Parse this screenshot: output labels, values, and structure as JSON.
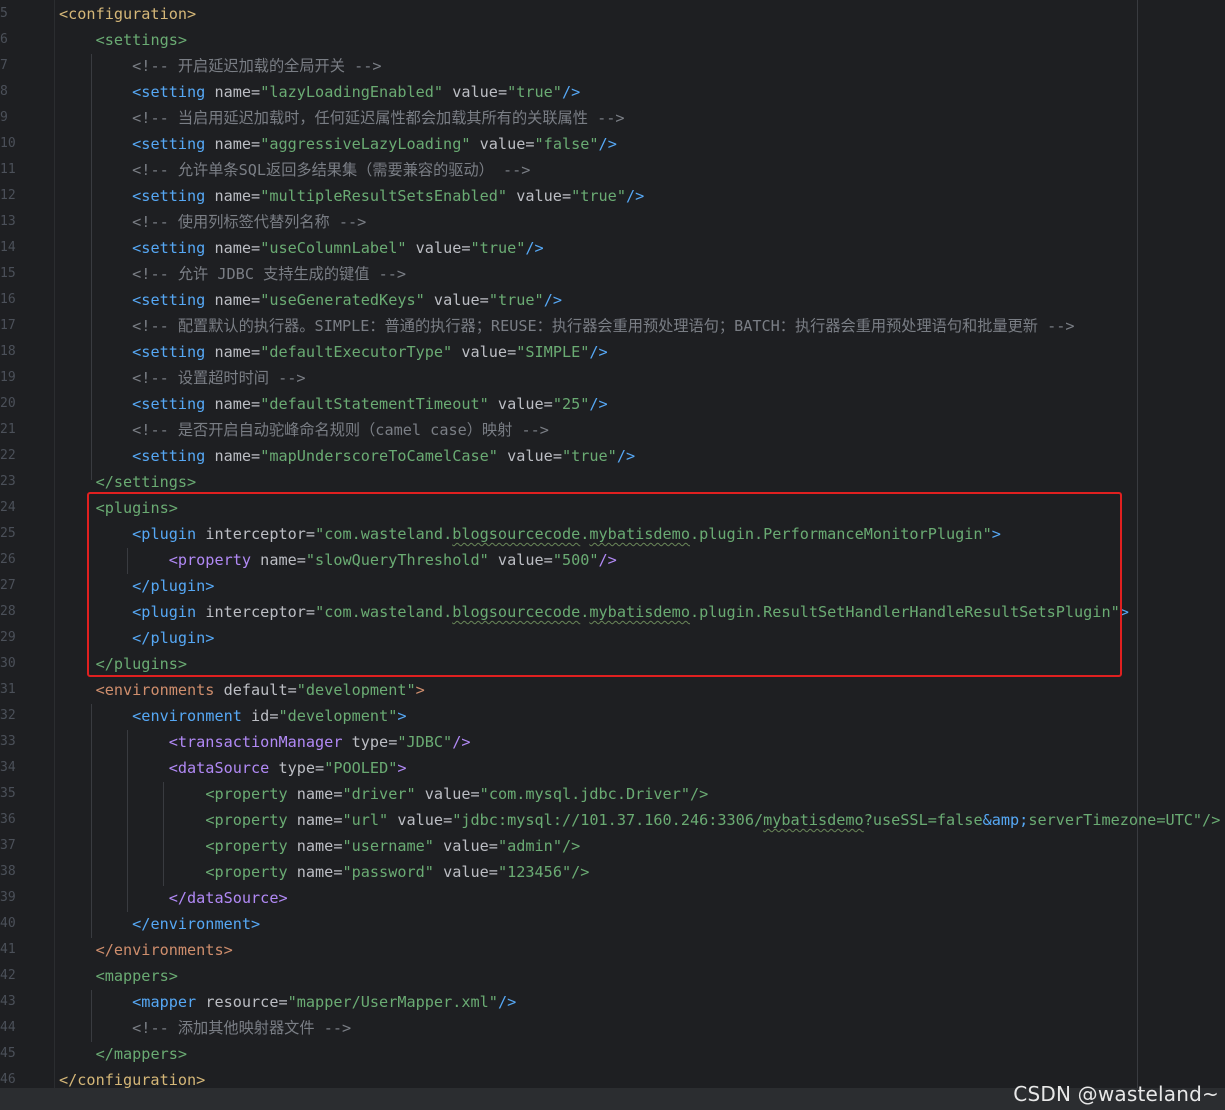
{
  "watermark": "CSDN @wasteland~",
  "colors": {
    "background": "#1e1f22",
    "highlight_box": "#e02020",
    "comment": "#7a7e85",
    "string": "#6aab73",
    "attribute": "#bcbec4"
  },
  "lines": [
    {
      "n": "5",
      "segs": [
        [
          "tag-y",
          "<configuration>"
        ]
      ]
    },
    {
      "n": "6",
      "segs": [
        [
          "sp",
          "    "
        ],
        [
          "tag-g",
          "<settings>"
        ]
      ]
    },
    {
      "n": "7",
      "segs": [
        [
          "sp",
          "        "
        ],
        [
          "cmt",
          "<!-- 开启延迟加载的全局开关 -->"
        ]
      ]
    },
    {
      "n": "8",
      "segs": [
        [
          "sp",
          "        "
        ],
        [
          "tag-b",
          "<setting "
        ],
        [
          "attr",
          "name"
        ],
        [
          "eq",
          "="
        ],
        [
          "str",
          "\"lazyLoadingEnabled\""
        ],
        [
          "attr",
          " value"
        ],
        [
          "eq",
          "="
        ],
        [
          "str",
          "\"true\""
        ],
        [
          "tag-b",
          "/>"
        ]
      ]
    },
    {
      "n": "9",
      "segs": [
        [
          "sp",
          "        "
        ],
        [
          "cmt",
          "<!-- 当启用延迟加载时，任何延迟属性都会加载其所有的关联属性 -->"
        ]
      ]
    },
    {
      "n": "10",
      "segs": [
        [
          "sp",
          "        "
        ],
        [
          "tag-b",
          "<setting "
        ],
        [
          "attr",
          "name"
        ],
        [
          "eq",
          "="
        ],
        [
          "str",
          "\"aggressiveLazyLoading\""
        ],
        [
          "attr",
          " value"
        ],
        [
          "eq",
          "="
        ],
        [
          "str",
          "\"false\""
        ],
        [
          "tag-b",
          "/>"
        ]
      ]
    },
    {
      "n": "11",
      "segs": [
        [
          "sp",
          "        "
        ],
        [
          "cmt",
          "<!-- 允许单条SQL返回多结果集（需要兼容的驱动） -->"
        ]
      ]
    },
    {
      "n": "12",
      "segs": [
        [
          "sp",
          "        "
        ],
        [
          "tag-b",
          "<setting "
        ],
        [
          "attr",
          "name"
        ],
        [
          "eq",
          "="
        ],
        [
          "str",
          "\"multipleResultSetsEnabled\""
        ],
        [
          "attr",
          " value"
        ],
        [
          "eq",
          "="
        ],
        [
          "str",
          "\"true\""
        ],
        [
          "tag-b",
          "/>"
        ]
      ]
    },
    {
      "n": "13",
      "segs": [
        [
          "sp",
          "        "
        ],
        [
          "cmt",
          "<!-- 使用列标签代替列名称 -->"
        ]
      ]
    },
    {
      "n": "14",
      "segs": [
        [
          "sp",
          "        "
        ],
        [
          "tag-b",
          "<setting "
        ],
        [
          "attr",
          "name"
        ],
        [
          "eq",
          "="
        ],
        [
          "str",
          "\"useColumnLabel\""
        ],
        [
          "attr",
          " value"
        ],
        [
          "eq",
          "="
        ],
        [
          "str",
          "\"true\""
        ],
        [
          "tag-b",
          "/>"
        ]
      ]
    },
    {
      "n": "15",
      "segs": [
        [
          "sp",
          "        "
        ],
        [
          "cmt",
          "<!-- 允许 JDBC 支持生成的键值 -->"
        ]
      ]
    },
    {
      "n": "16",
      "segs": [
        [
          "sp",
          "        "
        ],
        [
          "tag-b",
          "<setting "
        ],
        [
          "attr",
          "name"
        ],
        [
          "eq",
          "="
        ],
        [
          "str",
          "\"useGeneratedKeys\""
        ],
        [
          "attr",
          " value"
        ],
        [
          "eq",
          "="
        ],
        [
          "str",
          "\"true\""
        ],
        [
          "tag-b",
          "/>"
        ]
      ]
    },
    {
      "n": "17",
      "segs": [
        [
          "sp",
          "        "
        ],
        [
          "cmt",
          "<!-- 配置默认的执行器。SIMPLE：普通的执行器；REUSE：执行器会重用预处理语句；BATCH：执行器会重用预处理语句和批量更新 -->"
        ]
      ]
    },
    {
      "n": "18",
      "segs": [
        [
          "sp",
          "        "
        ],
        [
          "tag-b",
          "<setting "
        ],
        [
          "attr",
          "name"
        ],
        [
          "eq",
          "="
        ],
        [
          "str",
          "\"defaultExecutorType\""
        ],
        [
          "attr",
          " value"
        ],
        [
          "eq",
          "="
        ],
        [
          "str",
          "\"SIMPLE\""
        ],
        [
          "tag-b",
          "/>"
        ]
      ]
    },
    {
      "n": "19",
      "segs": [
        [
          "sp",
          "        "
        ],
        [
          "cmt",
          "<!-- 设置超时时间 -->"
        ]
      ]
    },
    {
      "n": "20",
      "segs": [
        [
          "sp",
          "        "
        ],
        [
          "tag-b",
          "<setting "
        ],
        [
          "attr",
          "name"
        ],
        [
          "eq",
          "="
        ],
        [
          "str",
          "\"defaultStatementTimeout\""
        ],
        [
          "attr",
          " value"
        ],
        [
          "eq",
          "="
        ],
        [
          "str",
          "\"25\""
        ],
        [
          "tag-b",
          "/>"
        ]
      ]
    },
    {
      "n": "21",
      "segs": [
        [
          "sp",
          "        "
        ],
        [
          "cmt",
          "<!-- 是否开启自动驼峰命名规则（camel case）映射 -->"
        ]
      ]
    },
    {
      "n": "22",
      "segs": [
        [
          "sp",
          "        "
        ],
        [
          "tag-b",
          "<setting "
        ],
        [
          "attr",
          "name"
        ],
        [
          "eq",
          "="
        ],
        [
          "str",
          "\"mapUnderscoreToCamelCase\""
        ],
        [
          "attr",
          " value"
        ],
        [
          "eq",
          "="
        ],
        [
          "str",
          "\"true\""
        ],
        [
          "tag-b",
          "/>"
        ]
      ]
    },
    {
      "n": "23",
      "segs": [
        [
          "sp",
          "    "
        ],
        [
          "tag-g",
          "</settings>"
        ]
      ]
    },
    {
      "n": "24",
      "segs": [
        [
          "sp",
          "    "
        ],
        [
          "tag-g",
          "<plugins>"
        ]
      ]
    },
    {
      "n": "25",
      "segs": [
        [
          "sp",
          "        "
        ],
        [
          "tag-b",
          "<plugin "
        ],
        [
          "attr",
          "interceptor"
        ],
        [
          "eq",
          "="
        ],
        [
          "str",
          "\"com.wasteland."
        ],
        [
          "sq",
          "blogsourcecode"
        ],
        [
          "str",
          "."
        ],
        [
          "sq",
          "mybatisdemo"
        ],
        [
          "str",
          ".plugin.PerformanceMonitorPlugin\""
        ],
        [
          "tag-b",
          ">"
        ]
      ]
    },
    {
      "n": "26",
      "segs": [
        [
          "sp",
          "            "
        ],
        [
          "tag-p",
          "<property "
        ],
        [
          "attr",
          "name"
        ],
        [
          "eq",
          "="
        ],
        [
          "str",
          "\"slowQueryThreshold\""
        ],
        [
          "attr",
          " value"
        ],
        [
          "eq",
          "="
        ],
        [
          "str",
          "\"500\""
        ],
        [
          "tag-p",
          "/>"
        ]
      ]
    },
    {
      "n": "27",
      "segs": [
        [
          "sp",
          "        "
        ],
        [
          "tag-b",
          "</plugin>"
        ]
      ]
    },
    {
      "n": "28",
      "segs": [
        [
          "sp",
          "        "
        ],
        [
          "tag-b",
          "<plugin "
        ],
        [
          "attr",
          "interceptor"
        ],
        [
          "eq",
          "="
        ],
        [
          "str",
          "\"com.wasteland."
        ],
        [
          "sq",
          "blogsourcecode"
        ],
        [
          "str",
          "."
        ],
        [
          "sq",
          "mybatisdemo"
        ],
        [
          "str",
          ".plugin.ResultSetHandlerHandleResultSetsPlugin\""
        ],
        [
          "tag-b",
          ">"
        ]
      ]
    },
    {
      "n": "29",
      "segs": [
        [
          "sp",
          "        "
        ],
        [
          "tag-b",
          "</plugin>"
        ]
      ]
    },
    {
      "n": "30",
      "segs": [
        [
          "sp",
          "    "
        ],
        [
          "tag-g",
          "</plugins>"
        ]
      ]
    },
    {
      "n": "31",
      "segs": [
        [
          "sp",
          "    "
        ],
        [
          "tag-o",
          "<environments "
        ],
        [
          "attr",
          "default"
        ],
        [
          "eq",
          "="
        ],
        [
          "str",
          "\"development\""
        ],
        [
          "tag-o",
          ">"
        ]
      ]
    },
    {
      "n": "32",
      "segs": [
        [
          "sp",
          "        "
        ],
        [
          "tag-b",
          "<environment "
        ],
        [
          "attr",
          "id"
        ],
        [
          "eq",
          "="
        ],
        [
          "str",
          "\"development\""
        ],
        [
          "tag-b",
          ">"
        ]
      ]
    },
    {
      "n": "33",
      "segs": [
        [
          "sp",
          "            "
        ],
        [
          "tag-p",
          "<transactionManager "
        ],
        [
          "attr",
          "type"
        ],
        [
          "eq",
          "="
        ],
        [
          "str",
          "\"JDBC\""
        ],
        [
          "tag-p",
          "/>"
        ]
      ]
    },
    {
      "n": "34",
      "segs": [
        [
          "sp",
          "            "
        ],
        [
          "tag-p",
          "<dataSource "
        ],
        [
          "attr",
          "type"
        ],
        [
          "eq",
          "="
        ],
        [
          "str",
          "\"POOLED\""
        ],
        [
          "tag-p",
          ">"
        ]
      ]
    },
    {
      "n": "35",
      "segs": [
        [
          "sp",
          "                "
        ],
        [
          "tag-g",
          "<property "
        ],
        [
          "attr",
          "name"
        ],
        [
          "eq",
          "="
        ],
        [
          "str",
          "\"driver\""
        ],
        [
          "attr",
          " value"
        ],
        [
          "eq",
          "="
        ],
        [
          "str",
          "\"com.mysql.jdbc.Driver\""
        ],
        [
          "tag-g",
          "/>"
        ]
      ]
    },
    {
      "n": "36",
      "segs": [
        [
          "sp",
          "                "
        ],
        [
          "tag-g",
          "<property "
        ],
        [
          "attr",
          "name"
        ],
        [
          "eq",
          "="
        ],
        [
          "str",
          "\"url\""
        ],
        [
          "attr",
          " value"
        ],
        [
          "eq",
          "="
        ],
        [
          "str",
          "\"jdbc:mysql://101.37.160.246:3306/"
        ],
        [
          "sq",
          "mybatisdemo"
        ],
        [
          "str",
          "?useSSL=false"
        ],
        [
          "ent",
          "&amp;"
        ],
        [
          "str",
          "serverTimezone=UTC\""
        ],
        [
          "tag-g",
          "/>"
        ]
      ]
    },
    {
      "n": "37",
      "segs": [
        [
          "sp",
          "                "
        ],
        [
          "tag-g",
          "<property "
        ],
        [
          "attr",
          "name"
        ],
        [
          "eq",
          "="
        ],
        [
          "str",
          "\"username\""
        ],
        [
          "attr",
          " value"
        ],
        [
          "eq",
          "="
        ],
        [
          "str",
          "\"admin\""
        ],
        [
          "tag-g",
          "/>"
        ]
      ]
    },
    {
      "n": "38",
      "segs": [
        [
          "sp",
          "                "
        ],
        [
          "tag-g",
          "<property "
        ],
        [
          "attr",
          "name"
        ],
        [
          "eq",
          "="
        ],
        [
          "str",
          "\"password\""
        ],
        [
          "attr",
          " value"
        ],
        [
          "eq",
          "="
        ],
        [
          "str",
          "\"123456\""
        ],
        [
          "tag-g",
          "/>"
        ]
      ]
    },
    {
      "n": "39",
      "segs": [
        [
          "sp",
          "            "
        ],
        [
          "tag-p",
          "</dataSource>"
        ]
      ]
    },
    {
      "n": "40",
      "segs": [
        [
          "sp",
          "        "
        ],
        [
          "tag-b",
          "</environment>"
        ]
      ]
    },
    {
      "n": "41",
      "segs": [
        [
          "sp",
          "    "
        ],
        [
          "tag-o",
          "</environments>"
        ]
      ]
    },
    {
      "n": "42",
      "segs": [
        [
          "sp",
          "    "
        ],
        [
          "tag-g",
          "<mappers>"
        ]
      ]
    },
    {
      "n": "43",
      "segs": [
        [
          "sp",
          "        "
        ],
        [
          "tag-b",
          "<mapper "
        ],
        [
          "attr",
          "resource"
        ],
        [
          "eq",
          "="
        ],
        [
          "str",
          "\"mapper/UserMapper.xml\""
        ],
        [
          "tag-b",
          "/>"
        ]
      ]
    },
    {
      "n": "44",
      "segs": [
        [
          "sp",
          "        "
        ],
        [
          "cmt",
          "<!-- 添加其他映射器文件 -->"
        ]
      ]
    },
    {
      "n": "45",
      "segs": [
        [
          "sp",
          "    "
        ],
        [
          "tag-g",
          "</mappers>"
        ]
      ]
    },
    {
      "n": "46",
      "segs": [
        [
          "tag-y",
          "</configuration>"
        ]
      ]
    }
  ]
}
